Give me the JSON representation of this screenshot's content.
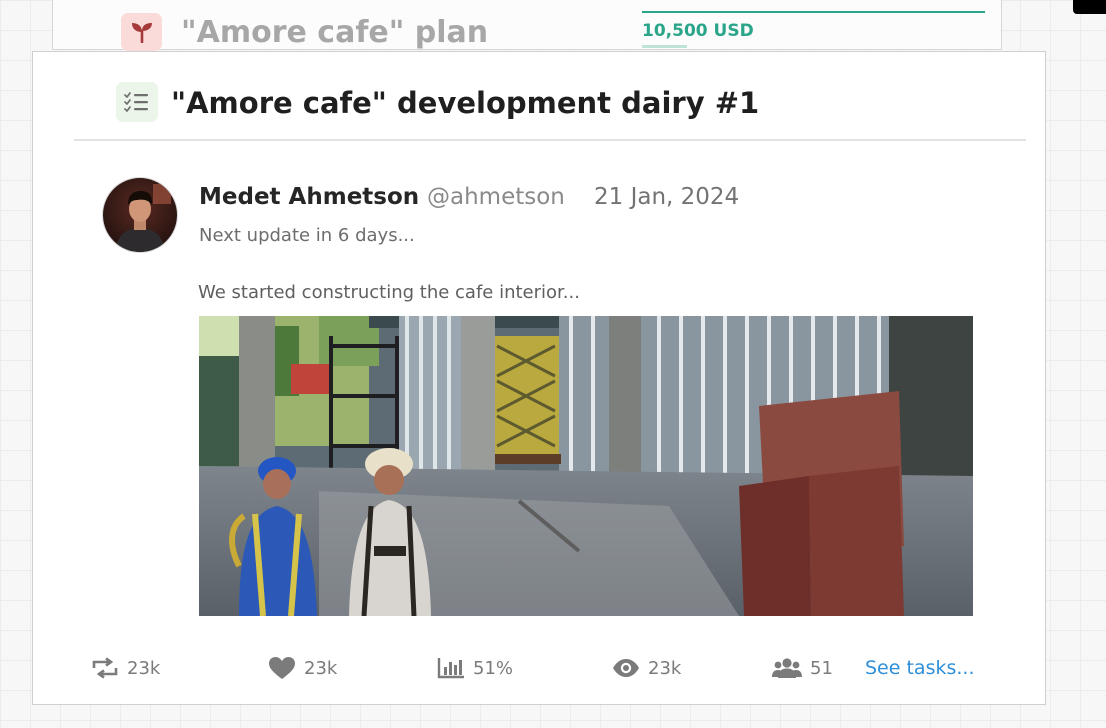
{
  "background_card": {
    "title": "\"Amore cafe\" plan",
    "amount": "10,500 USD",
    "icon": "sprout-icon"
  },
  "dairy": {
    "title": "\"Amore cafe\" development dairy #1",
    "icon": "checklist-icon"
  },
  "post": {
    "author_name": "Medet Ahmetson",
    "author_handle": "@ahmetson",
    "date": "21 Jan, 2024",
    "next_update": "Next update in 6 days...",
    "text": "We started constructing the cafe interior..."
  },
  "stats": {
    "reposts": "23k",
    "likes": "23k",
    "analytics": "51%",
    "views": "23k",
    "members": "51",
    "see_tasks": "See tasks..."
  },
  "colors": {
    "accent_green": "#2aa58a",
    "link_blue": "#2f8fd8",
    "plan_icon_bg": "#fbdada",
    "dairy_icon_bg": "#ebf5e9"
  }
}
